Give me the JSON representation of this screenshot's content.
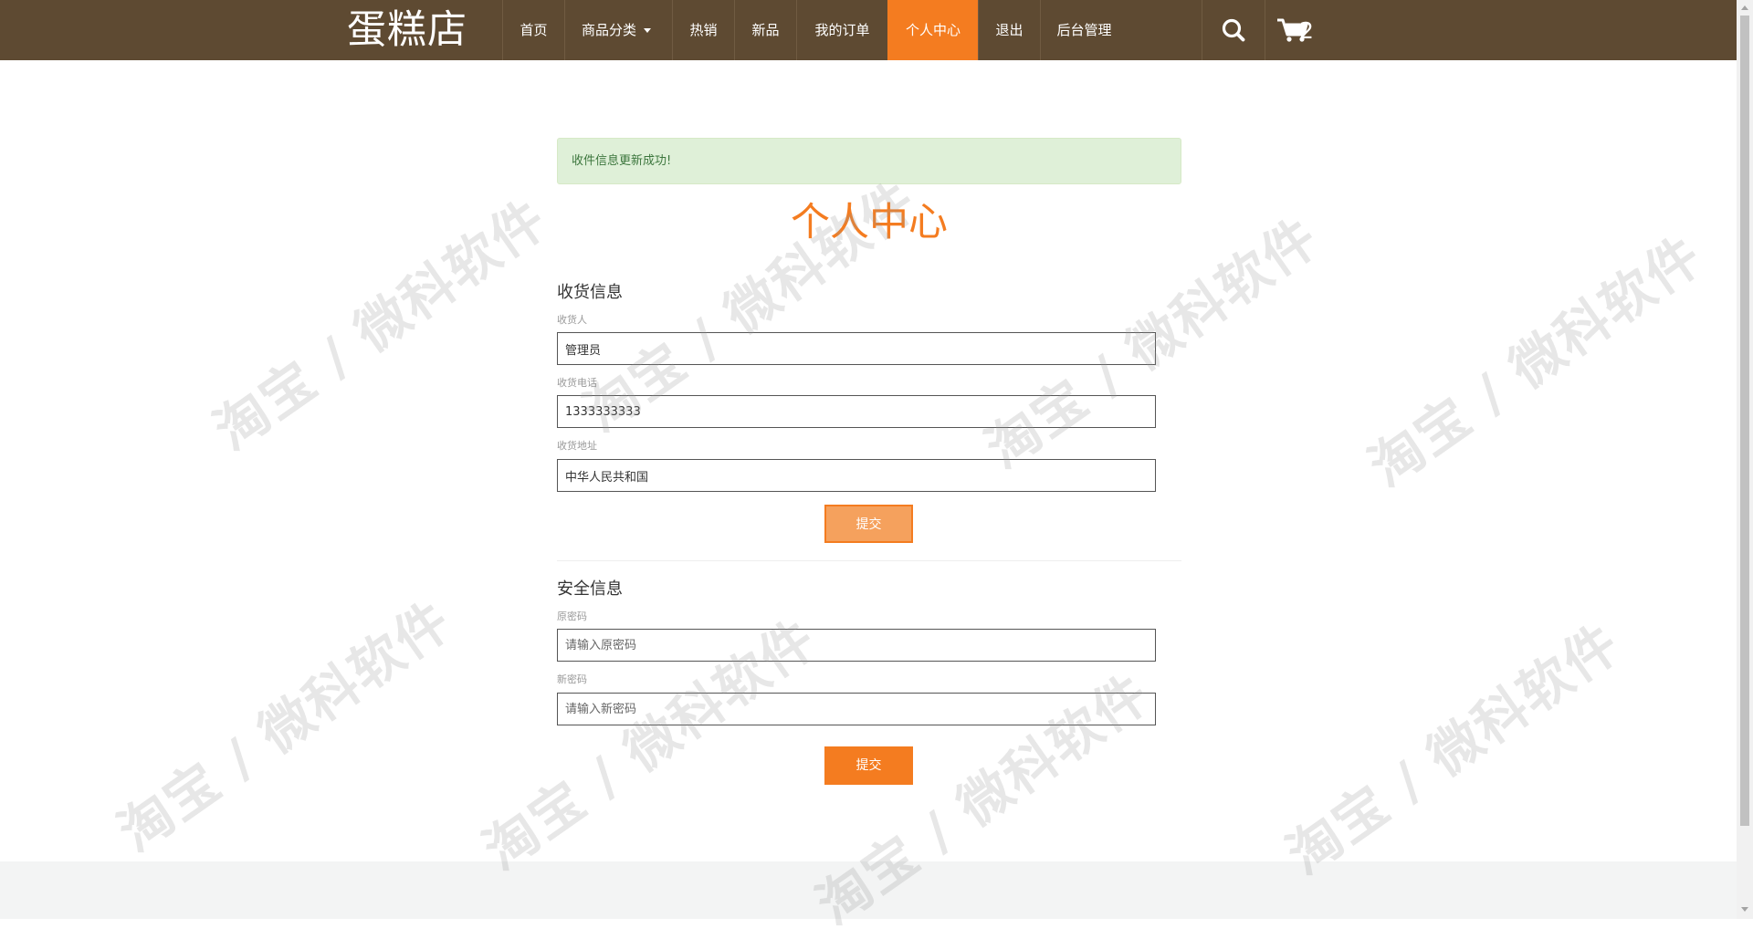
{
  "brand": "蛋糕店",
  "nav": {
    "items": [
      {
        "label": "首页"
      },
      {
        "label": "商品分类"
      },
      {
        "label": "热销"
      },
      {
        "label": "新品"
      },
      {
        "label": "我的订单"
      },
      {
        "label": "个人中心",
        "active": true
      },
      {
        "label": "退出"
      },
      {
        "label": "后台管理"
      }
    ],
    "cart_count": "2",
    "icons": {
      "search": "search-icon",
      "cart": "cart-icon",
      "dropdown": "caret-down-icon"
    }
  },
  "alert": {
    "message": "收件信息更新成功!"
  },
  "page_title": "个人中心",
  "shipping": {
    "title": "收货信息",
    "name_label": "收货人",
    "name_value": "管理员",
    "phone_label": "收货电话",
    "phone_value": "1333333333",
    "address_label": "收货地址",
    "address_value": "中华人民共和国",
    "submit_label": "提交"
  },
  "security": {
    "title": "安全信息",
    "old_label": "原密码",
    "old_placeholder": "请输入原密码",
    "new_label": "新密码",
    "new_placeholder": "请输入新密码",
    "submit_label": "提交"
  },
  "watermark": "淘宝 / 微科软件",
  "colors": {
    "navbar": "#5e4a32",
    "accent": "#f47c20",
    "alert_bg": "#dff0d8",
    "alert_text": "#3c763d"
  }
}
